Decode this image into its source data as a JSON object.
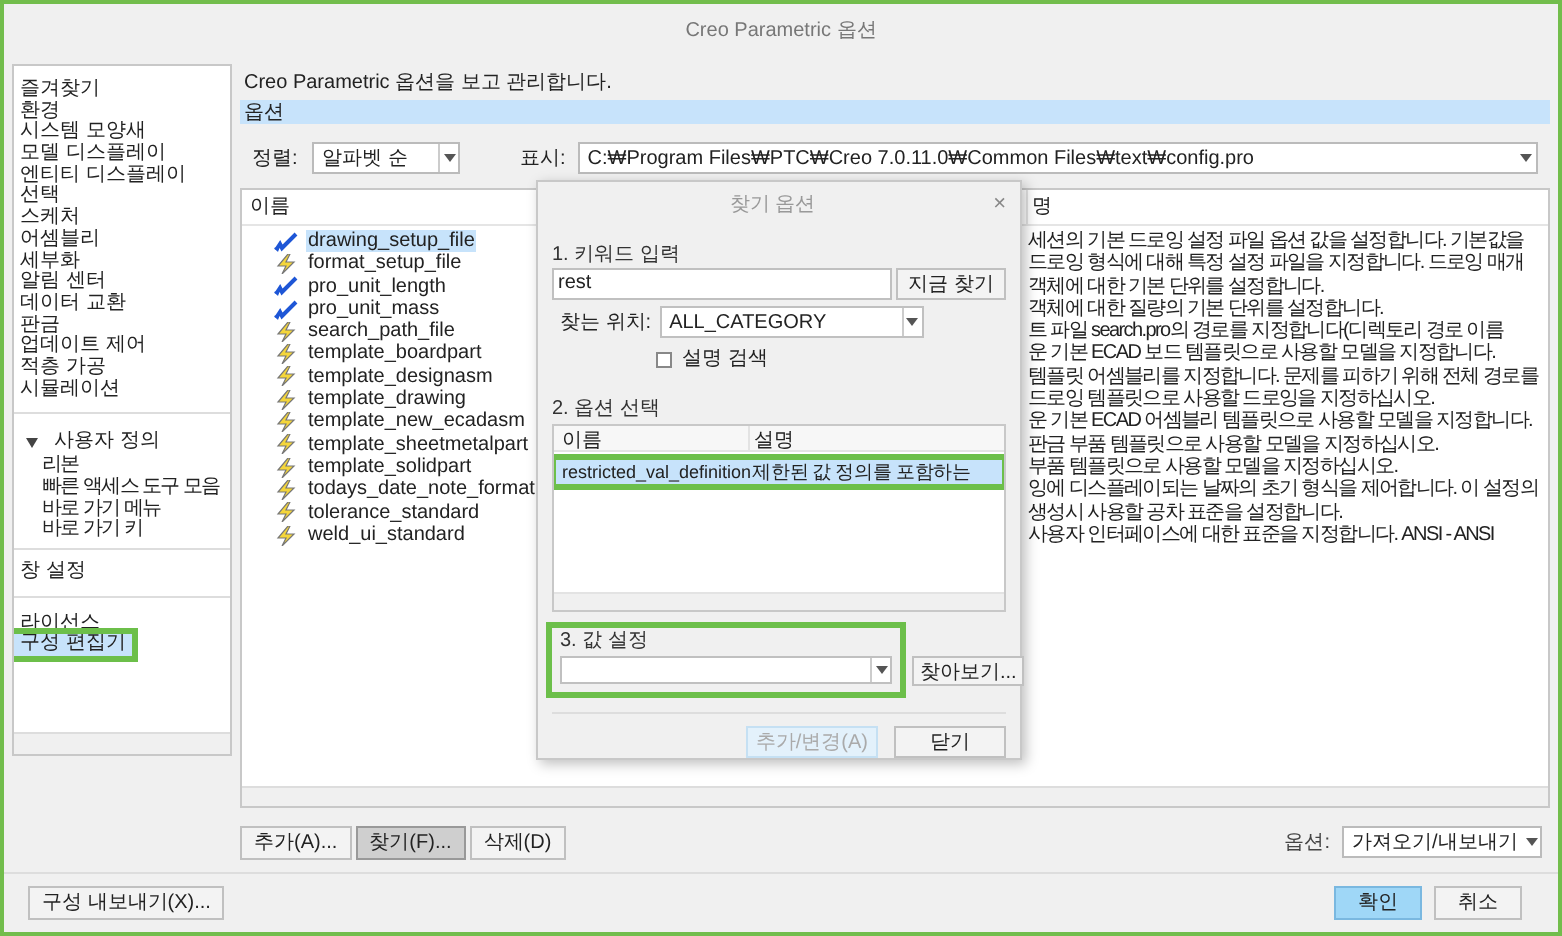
{
  "window": {
    "title": "Creo Parametric 옵션"
  },
  "sidebar": {
    "sections": [
      {
        "items": [
          {
            "label": "즐겨찾기",
            "selected": false,
            "highlighted": false
          },
          {
            "label": "환경",
            "selected": false,
            "highlighted": false
          },
          {
            "label": "시스템 모양새",
            "selected": false,
            "highlighted": false
          },
          {
            "label": "모델 디스플레이",
            "selected": false,
            "highlighted": false
          },
          {
            "label": "엔티티 디스플레이",
            "selected": false,
            "highlighted": false
          },
          {
            "label": "선택",
            "selected": false,
            "highlighted": false
          },
          {
            "label": "스케처",
            "selected": false,
            "highlighted": false
          },
          {
            "label": "어셈블리",
            "selected": false,
            "highlighted": false
          },
          {
            "label": "세부화",
            "selected": false,
            "highlighted": false
          },
          {
            "label": "알림 센터",
            "selected": false,
            "highlighted": false
          },
          {
            "label": "데이터 교환",
            "selected": false,
            "highlighted": false
          },
          {
            "label": "판금",
            "selected": false,
            "highlighted": false
          },
          {
            "label": "업데이트 제어",
            "selected": false,
            "highlighted": false
          },
          {
            "label": "적층 가공",
            "selected": false,
            "highlighted": false
          },
          {
            "label": "시뮬레이션",
            "selected": false,
            "highlighted": false
          }
        ]
      },
      {
        "items": [
          {
            "label": "사용자 정의",
            "selected": false,
            "highlighted": false,
            "expanded": true,
            "children": [
              {
                "label": "리본",
                "selected": false,
                "highlighted": false
              },
              {
                "label": "빠른 액세스 도구 모음",
                "selected": false,
                "highlighted": false
              },
              {
                "label": "바로 가기 메뉴",
                "selected": false,
                "highlighted": false
              },
              {
                "label": "바로 가기 키",
                "selected": false,
                "highlighted": false
              }
            ]
          }
        ]
      },
      {
        "items": [
          {
            "label": "창 설정",
            "selected": false,
            "highlighted": false
          }
        ]
      },
      {
        "items": [
          {
            "label": "라이선스",
            "selected": false,
            "highlighted": false
          },
          {
            "label": "구성 편집기",
            "selected": true,
            "highlighted": true
          }
        ]
      }
    ]
  },
  "header": {
    "text": "Creo Parametric 옵션을 보고 관리합니다.",
    "section": "옵션"
  },
  "sort": {
    "label": "정렬:",
    "value": "알파벳 순"
  },
  "show": {
    "label": "표시:",
    "value": "C:₩Program Files₩PTC₩Creo 7.0.11.0₩Common Files₩text₩config.pro"
  },
  "table": {
    "columns": [
      "이름",
      "명"
    ],
    "rows": [
      {
        "name": "drawing_setup_file",
        "kind": "modified",
        "selected": true,
        "description": "세션의 기본 드로잉 설정 파일 옵션 값을 설정합니다. 기본값을"
      },
      {
        "name": "format_setup_file",
        "kind": "default",
        "selected": false,
        "description": "드로잉 형식에 대해 특정 설정 파일을 지정합니다. 드로잉 매개"
      },
      {
        "name": "pro_unit_length",
        "kind": "modified",
        "selected": false,
        "description": "객체에 대한 기본 단위를 설정합니다."
      },
      {
        "name": "pro_unit_mass",
        "kind": "modified",
        "selected": false,
        "description": "객체에 대한 질량의 기본 단위를 설정합니다."
      },
      {
        "name": "search_path_file",
        "kind": "default",
        "selected": false,
        "description": "트 파일 search.pro의 경로를 지정합니다(디렉토리 경로 이름"
      },
      {
        "name": "template_boardpart",
        "kind": "default",
        "selected": false,
        "description": "운 기본 ECAD 보드 템플릿으로 사용할 모델을 지정합니다."
      },
      {
        "name": "template_designasm",
        "kind": "default",
        "selected": false,
        "description": "템플릿 어셈블리를 지정합니다. 문제를 피하기 위해 전체 경로를"
      },
      {
        "name": "template_drawing",
        "kind": "default",
        "selected": false,
        "description": "드로잉 템플릿으로 사용할 드로잉을 지정하십시오."
      },
      {
        "name": "template_new_ecadasm",
        "kind": "default",
        "selected": false,
        "description": "운 기본 ECAD 어셈블리 템플릿으로 사용할 모델을 지정합니다."
      },
      {
        "name": "template_sheetmetalpart",
        "kind": "default",
        "selected": false,
        "description": "판금 부품 템플릿으로 사용할 모델을 지정하십시오."
      },
      {
        "name": "template_solidpart",
        "kind": "default",
        "selected": false,
        "description": "부품 템플릿으로 사용할 모델을 지정하십시오."
      },
      {
        "name": "todays_date_note_format",
        "kind": "default",
        "selected": false,
        "description": "잉에 디스플레이되는 날짜의 초기 형식을 제어합니다. 이 설정의"
      },
      {
        "name": "tolerance_standard",
        "kind": "default",
        "selected": false,
        "description": "생성시 사용할 공차 표준을 설정합니다."
      },
      {
        "name": "weld_ui_standard",
        "kind": "default",
        "selected": false,
        "description": "사용자 인터페이스에 대한 표준을 지정합니다. ANSI - ANSI"
      }
    ]
  },
  "actions": [
    {
      "label": "추가(A)...",
      "pressed": false
    },
    {
      "label": "찾기(F)...",
      "pressed": true
    },
    {
      "label": "삭제(D)",
      "pressed": false
    }
  ],
  "options": {
    "label": "옵션:",
    "value": "가져오기/내보내기"
  },
  "export_button": "구성 내보내기(X)...",
  "footer_buttons": [
    {
      "label": "확인",
      "primary": true
    },
    {
      "label": "취소",
      "primary": false
    }
  ],
  "dialog": {
    "title": "찾기 옵션",
    "close": "×",
    "keyword": {
      "label": "1. 키워드 입력",
      "value": "rest",
      "button": "지금 찾기"
    },
    "location": {
      "label": "찾는 위치:",
      "value": "ALL_CATEGORY"
    },
    "search_description": {
      "label": "설명 검색",
      "checked": false
    },
    "select": {
      "label": "2. 옵션 선택",
      "columns": [
        "이름",
        "설명"
      ],
      "rows": [
        {
          "name": "restricted_val_definition",
          "description": "제한된 값 정의를 포함하는",
          "selected": true,
          "highlighted": true
        }
      ]
    },
    "value": {
      "label": "3. 값 설정",
      "browse": "찾아보기...",
      "highlighted": true
    },
    "buttons": [
      {
        "label": "추가/변경(A)",
        "disabled": true
      },
      {
        "label": "닫기",
        "disabled": false
      }
    ]
  }
}
